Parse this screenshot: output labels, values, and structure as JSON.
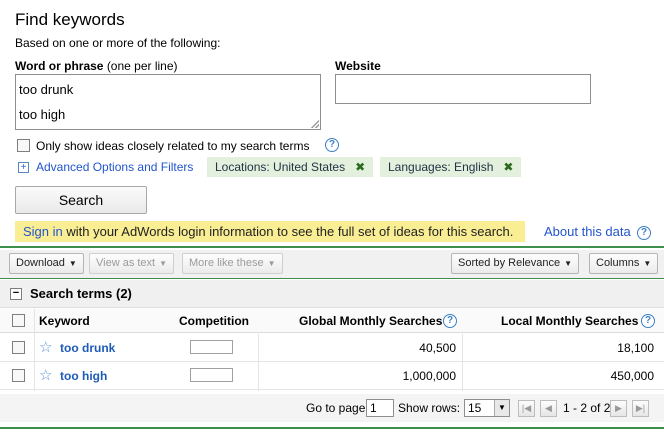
{
  "find": {
    "title": "Find keywords",
    "subtitle": "Based on one or more of the following:",
    "word_label_bold": "Word or phrase",
    "word_label_hint": "(one per line)",
    "words": [
      "too drunk",
      "too high"
    ],
    "website_label": "Website",
    "website_value": "",
    "closely_related_label": "Only show ideas closely related to my search terms",
    "advanced_label": "Advanced Options and Filters",
    "location_filter": "Locations: United States",
    "language_filter": "Languages: English",
    "search_button": "Search",
    "notice_link": "Sign in",
    "notice_text": " with your AdWords login information to see the full set of ideas for this search.",
    "about_link": "About this data"
  },
  "toolbar": {
    "download": "Download",
    "view_as_text": "View as text",
    "more_like_these": "More like these",
    "sort": "Sorted by Relevance",
    "columns": "Columns"
  },
  "results": {
    "section_title": "Search terms (2)",
    "columns": {
      "keyword": "Keyword",
      "competition": "Competition",
      "global": "Global Monthly Searches",
      "local": "Local Monthly Searches"
    },
    "rows": [
      {
        "keyword": "too drunk",
        "competition": 0,
        "global": "40,500",
        "local": "18,100"
      },
      {
        "keyword": "too high",
        "competition": 0,
        "global": "1,000,000",
        "local": "450,000"
      }
    ]
  },
  "pager": {
    "go_to_page_label": "Go to page:",
    "page_value": "1",
    "show_rows_label": "Show rows:",
    "rows_value": "15",
    "range": "1 - 2 of 2"
  },
  "colors": {
    "accent_green": "#3e8e4c",
    "link_blue": "#2255cc",
    "notice_yellow": "#f9ee93",
    "filter_pill": "#e2f0dd"
  }
}
